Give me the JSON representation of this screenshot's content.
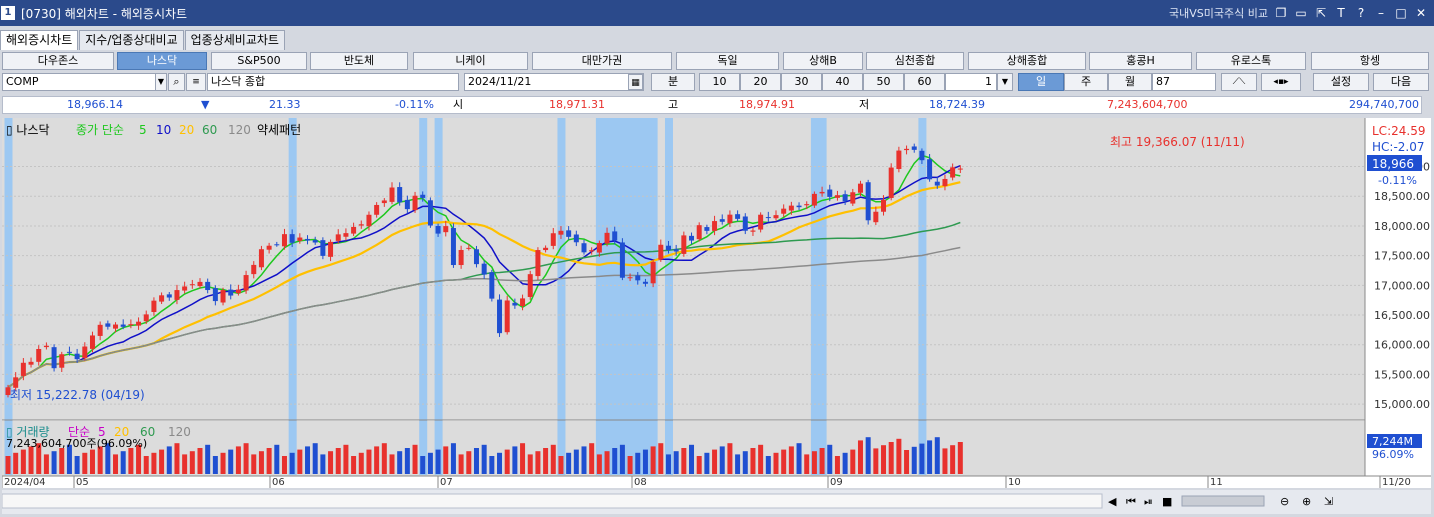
{
  "window": {
    "title": "[0730] 해외차트 - 해외증시차트",
    "right_label": "국내VS미국주식 비교",
    "icons": [
      "window-icon",
      "restore-icon",
      "pin-icon",
      "text-icon",
      "help-icon",
      "minimize-icon",
      "maximize-icon",
      "close-icon"
    ]
  },
  "tabs": [
    "해외증시차트",
    "지수/업종상대비교",
    "업종상세비교차트"
  ],
  "markets": [
    "다우존스",
    "나스닥",
    "S&P500",
    "반도체",
    "니케이",
    "대만가권",
    "독일",
    "상해B",
    "심천종합",
    "상해종합",
    "홍콩H",
    "유로스톡",
    "항셍"
  ],
  "active_market": "나스닥",
  "symbol": {
    "code": "COMP",
    "name": "나스닥 종합",
    "date": "2024/11/21"
  },
  "period": {
    "minute_label": "분",
    "minutes": [
      "10",
      "20",
      "30",
      "40",
      "50",
      "60"
    ],
    "unit_value": "1",
    "day": "일",
    "week": "주",
    "month": "월",
    "count": "87",
    "settings": "설정",
    "next": "다음"
  },
  "quote": {
    "price": "18,966.14",
    "change_arrow": "▼",
    "change": "21.33",
    "change_pct": "-0.11%",
    "open_label": "시",
    "open": "18,971.31",
    "high_label": "고",
    "high": "18,974.91",
    "low_label": "저",
    "low": "18,724.39",
    "amount": "7,243,604,700",
    "volume": "294,740,700"
  },
  "colors": {
    "up": "#e8312d",
    "down": "#1f4fd1",
    "ma5": "#1ec81e",
    "ma10": "#1010c8",
    "ma20": "#ffc000",
    "ma60": "#2e9a50",
    "ma120": "#8a8a8a",
    "highlight": "#9cc8f2"
  },
  "chart_data": {
    "type": "candlestick",
    "title": "나스닥",
    "legend": {
      "price_label": "종가 단순",
      "periods": [
        "5",
        "10",
        "20",
        "60",
        "120"
      ],
      "pattern": "약세패턴"
    },
    "ylim": [
      14800,
      19750
    ],
    "yticks": [
      "15,000.00",
      "15,500.00",
      "16,000.00",
      "16,500.00",
      "17,000.00",
      "17,500.00",
      "18,000.00",
      "18,500.00",
      "19,000.00"
    ],
    "x_labels": [
      "2024/04",
      "05",
      "06",
      "07",
      "08",
      "09",
      "10",
      "11",
      "11/20"
    ],
    "max_annotation": "최고 19,366.07 (11/11)",
    "min_annotation": "최저 15,222.78 (04/19)",
    "right_labels": {
      "lc": "LC:24.59",
      "hc": "HC:-2.07",
      "last": "18,966",
      "pct": "-0.11%"
    },
    "volume": {
      "label": "거래량",
      "ma_label": "단순",
      "periods": [
        "5",
        "20",
        "60",
        "120"
      ],
      "value_text": "7,243,604,700주(96.09%)",
      "last_label": "7,244M",
      "last_pct": "96.09%"
    },
    "closes": [
      15283,
      15451,
      15696,
      15712,
      15928,
      15983,
      15605,
      15840,
      15865,
      15757,
      15970,
      16156,
      16335,
      16303,
      16340,
      16302,
      16346,
      16388,
      16511,
      16742,
      16832,
      16795,
      16920,
      16981,
      17019,
      17058,
      16921,
      16735,
      16920,
      16828,
      16929,
      17173,
      17344,
      17608,
      17667,
      17689,
      17862,
      17717,
      17805,
      17754,
      17721,
      17496,
      17732,
      17858,
      17879,
      17983,
      18028,
      18188,
      18353,
      18429,
      18647,
      18398,
      18283,
      18509,
      18472,
      18007,
      17871,
      17997,
      17342,
      17595,
      17631,
      17357,
      17181,
      16776,
      16195,
      16745,
      16660,
      16780,
      17188,
      17594,
      17632,
      17877,
      17918,
      17816,
      17725,
      17556,
      17592,
      17713,
      17884,
      17754,
      17128,
      17136,
      17084,
      17026,
      17395,
      17683,
      17592,
      17569,
      17841,
      17754,
      18013,
      17917,
      18082,
      18070,
      18190,
      18119,
      17919,
      17923,
      18189,
      18137,
      18182,
      18291,
      18342,
      18316,
      18367,
      18540,
      18573,
      18489,
      18518,
      18417,
      18567,
      18712,
      18095,
      18239,
      18439,
      18983,
      19269,
      19298,
      19281,
      19107,
      18785,
      18680,
      18791,
      18987,
      18966
    ],
    "highlight_bars": [
      0,
      37,
      54,
      56,
      72,
      77,
      78,
      79,
      80,
      81,
      82,
      83,
      84,
      86,
      105,
      106,
      119,
      140,
      168,
      183,
      186,
      198,
      199,
      210
    ]
  },
  "bottom": {
    "icons": [
      "scroll-left-icon",
      "prev-icon",
      "play-icon",
      "stop-icon",
      "next-icon",
      "zoom-out-icon",
      "zoom-in-icon"
    ]
  }
}
